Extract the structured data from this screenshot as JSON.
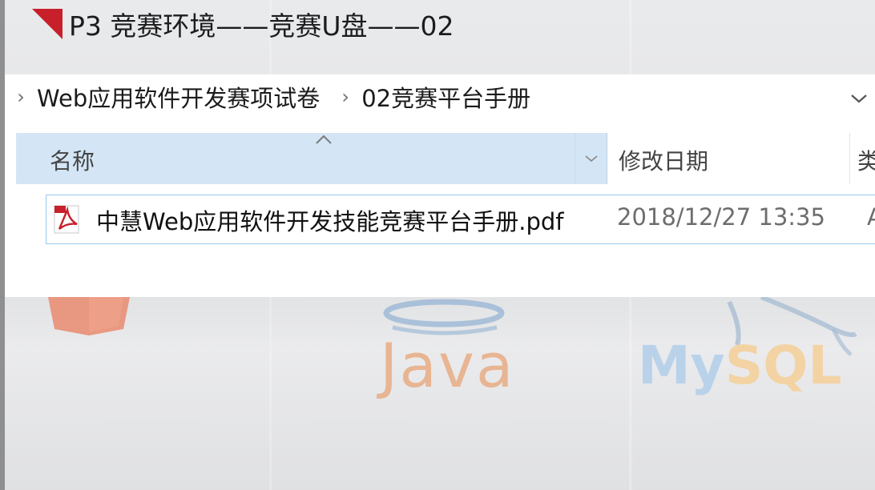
{
  "slide": {
    "title": "P3 竞赛环境——竞赛U盘——02",
    "accent_color": "#c8202a"
  },
  "explorer": {
    "breadcrumb": [
      {
        "label": "Web应用软件开发赛项试卷"
      },
      {
        "label": "02竞赛平台手册"
      }
    ],
    "columns": {
      "name": "名称",
      "date_modified": "修改日期",
      "next_partial": "类"
    },
    "files": [
      {
        "name": "中慧Web应用软件开发技能竞赛平台手册.pdf",
        "date_modified": "2018/12/27 13:35",
        "type_partial": "A",
        "icon": "pdf-file-icon"
      }
    ],
    "selection_color": "#99c9ef",
    "header_highlight_color": "#d4e6f6"
  },
  "background_logos": {
    "java": "Java",
    "mysql_a": "My",
    "mysql_b": "SQL"
  }
}
